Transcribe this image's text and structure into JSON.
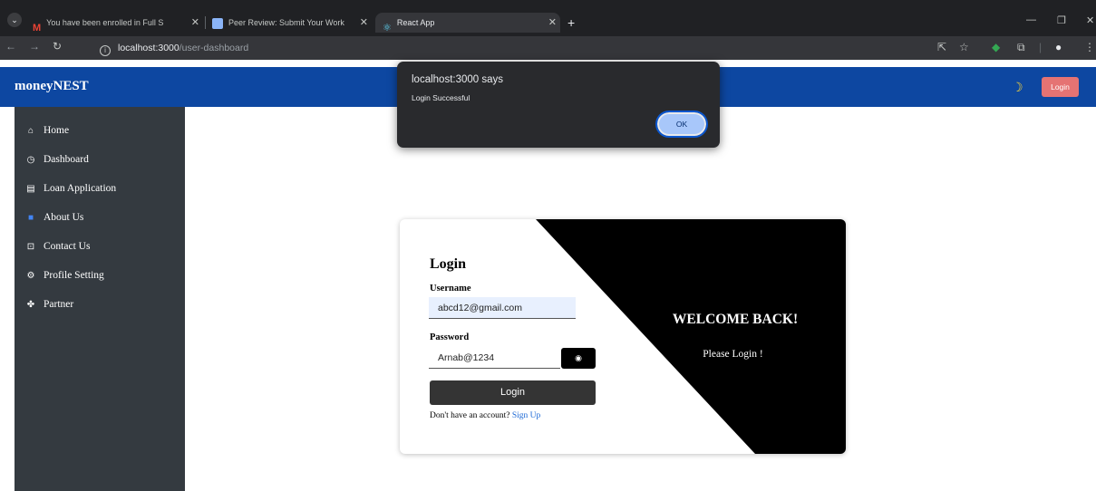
{
  "browser": {
    "tabs": [
      {
        "title": "You have been enrolled in Full S",
        "favicon": "gmail-icon"
      },
      {
        "title": "Peer Review: Submit Your Work",
        "favicon": "page-icon"
      },
      {
        "title": "React App",
        "favicon": "react-icon"
      }
    ],
    "url_host": "localhost:3000",
    "url_path": "/user-dashboard"
  },
  "app": {
    "brand": "moneyNEST",
    "header_login_label": "Login",
    "theme_icon": "moon-icon"
  },
  "sidebar": {
    "items": [
      {
        "label": "Home",
        "icon": "home-icon"
      },
      {
        "label": "Dashboard",
        "icon": "dashboard-icon"
      },
      {
        "label": "Loan Application",
        "icon": "loan-icon"
      },
      {
        "label": "About Us",
        "icon": "about-icon"
      },
      {
        "label": "Contact Us",
        "icon": "contact-icon"
      },
      {
        "label": "Profile Setting",
        "icon": "settings-icon"
      },
      {
        "label": "Partner",
        "icon": "partner-icon"
      }
    ]
  },
  "login_form": {
    "title": "Login",
    "username_label": "Username",
    "username_value": "abcd12@gmail.com",
    "password_label": "Password",
    "password_value": "Arnab@1234",
    "submit_label": "Login",
    "no_account_text": "Don't have an account?",
    "signup_link": "Sign Up",
    "welcome_heading": "WELCOME BACK!",
    "welcome_sub": "Please Login !"
  },
  "dialog": {
    "title": "localhost:3000 says",
    "message": "Login Successful",
    "ok_label": "OK"
  },
  "colors": {
    "header_bg": "#0d47a1",
    "sidebar_bg": "#343a40",
    "login_button_bg": "#e57373"
  }
}
